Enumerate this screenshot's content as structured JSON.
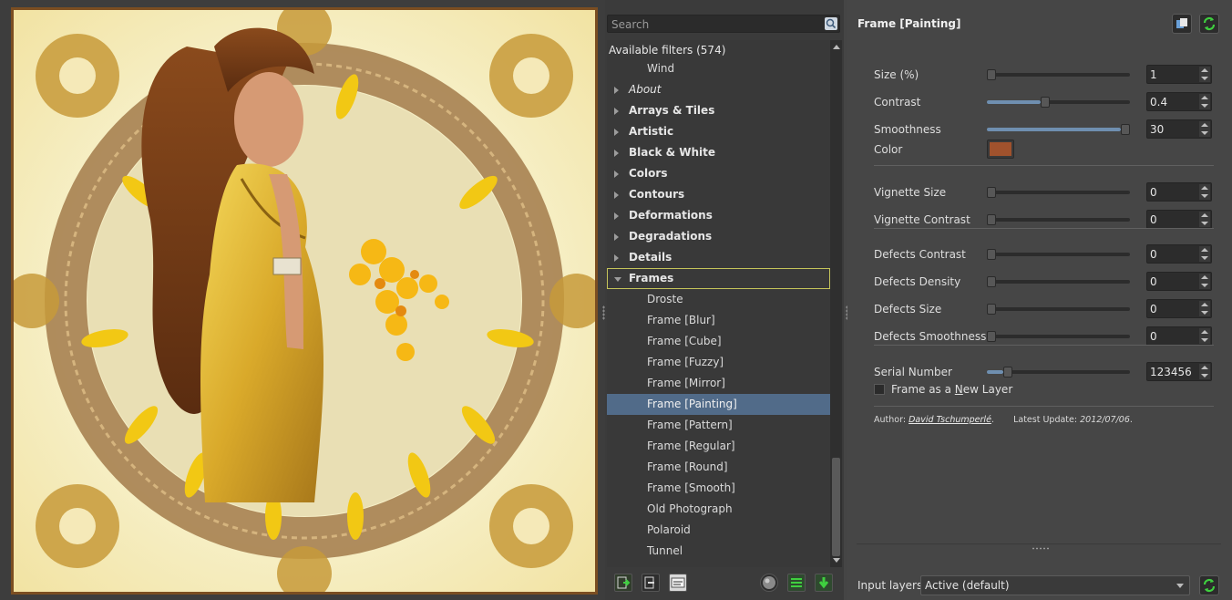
{
  "search": {
    "placeholder": "Search"
  },
  "tree": {
    "header": "Available filters (574)",
    "rows": [
      {
        "label": "Wind",
        "kind": "leaf"
      },
      {
        "label": "About",
        "kind": "cat-italic"
      },
      {
        "label": "Arrays & Tiles",
        "kind": "cat"
      },
      {
        "label": "Artistic",
        "kind": "cat"
      },
      {
        "label": "Black & White",
        "kind": "cat"
      },
      {
        "label": "Colors",
        "kind": "cat"
      },
      {
        "label": "Contours",
        "kind": "cat"
      },
      {
        "label": "Deformations",
        "kind": "cat"
      },
      {
        "label": "Degradations",
        "kind": "cat"
      },
      {
        "label": "Details",
        "kind": "cat"
      },
      {
        "label": "Frames",
        "kind": "cat-open"
      },
      {
        "label": "Droste",
        "kind": "leaf"
      },
      {
        "label": "Frame [Blur]",
        "kind": "leaf"
      },
      {
        "label": "Frame [Cube]",
        "kind": "leaf"
      },
      {
        "label": "Frame [Fuzzy]",
        "kind": "leaf"
      },
      {
        "label": "Frame [Mirror]",
        "kind": "leaf"
      },
      {
        "label": "Frame [Painting]",
        "kind": "leaf-selected"
      },
      {
        "label": "Frame [Pattern]",
        "kind": "leaf"
      },
      {
        "label": "Frame [Regular]",
        "kind": "leaf"
      },
      {
        "label": "Frame [Round]",
        "kind": "leaf"
      },
      {
        "label": "Frame [Smooth]",
        "kind": "leaf"
      },
      {
        "label": "Old Photograph",
        "kind": "leaf"
      },
      {
        "label": "Polaroid",
        "kind": "leaf"
      },
      {
        "label": "Tunnel",
        "kind": "leaf"
      }
    ]
  },
  "filter": {
    "title": "Frame [Painting]",
    "params": {
      "size": {
        "label": "Size (%)",
        "value": "1",
        "level": 0.0
      },
      "contrast": {
        "label": "Contrast",
        "value": "0.4",
        "level": 0.4
      },
      "smoothness": {
        "label": "Smoothness",
        "value": "30",
        "level": 1.0
      },
      "color": {
        "label": "Color",
        "value": "#a0522d"
      },
      "vignette_size": {
        "label": "Vignette Size",
        "value": "0",
        "level": 0.0
      },
      "vignette_contrast": {
        "label": "Vignette Contrast",
        "value": "0",
        "level": 0.0
      },
      "defects_contrast": {
        "label": "Defects Contrast",
        "value": "0",
        "level": 0.0
      },
      "defects_density": {
        "label": "Defects Density",
        "value": "0",
        "level": 0.0
      },
      "defects_size": {
        "label": "Defects Size",
        "value": "0",
        "level": 0.0
      },
      "defects_smoothness": {
        "label": "Defects Smoothness",
        "value": "0",
        "level": 0.0
      },
      "serial_number": {
        "label": "Serial Number",
        "value": "123456",
        "level": 0.12
      },
      "new_layer": {
        "label_pre": "Frame as a ",
        "label_key": "N",
        "label_post": "ew Layer",
        "checked": false
      }
    },
    "author_label": "Author:",
    "author": "David Tschumperlé",
    "update_label": "Latest Update:",
    "update_date": "2012/07/06"
  },
  "input_layers": {
    "label": "Input layers",
    "value": "Active (default)"
  },
  "colors": {
    "accent": "#516b89",
    "frame_border": "#7b4e21",
    "open_outline": "#c5c45a"
  }
}
